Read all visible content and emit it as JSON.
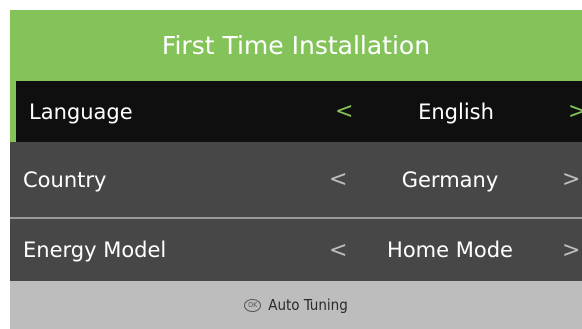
{
  "header": {
    "title": "First Time Installation"
  },
  "rows": [
    {
      "label": "Language",
      "value": "English",
      "left_arrow": "<",
      "right_arrow": ">"
    },
    {
      "label": "Country",
      "value": "Germany",
      "left_arrow": "<",
      "right_arrow": ">"
    },
    {
      "label": "Energy Model",
      "value": "Home Mode",
      "left_arrow": "<",
      "right_arrow": ">"
    }
  ],
  "footer": {
    "ok_icon_text": "OK",
    "label": "Auto Tuning"
  },
  "colors": {
    "accent_green": "#84c35a",
    "selected_row_bg": "#0f0f0f",
    "row_bg": "#474747",
    "footer_bg": "#bdbdbd"
  }
}
